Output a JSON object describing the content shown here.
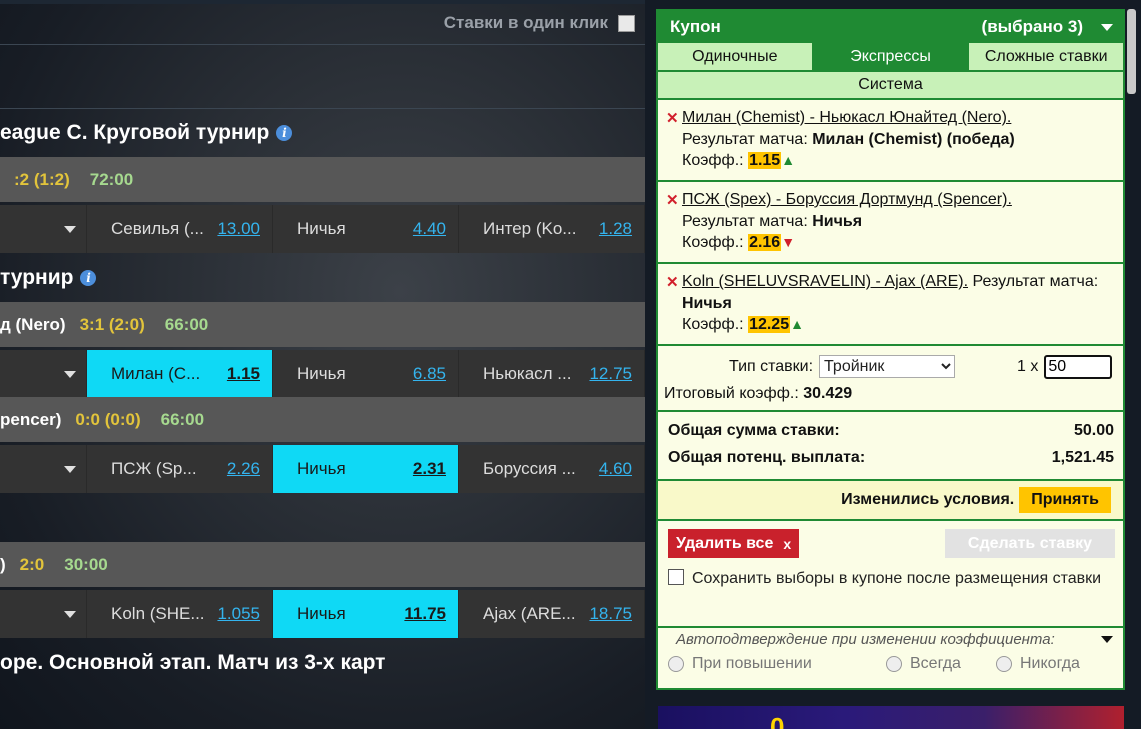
{
  "oneclick": {
    "label": "Ставки в один клик"
  },
  "leagues": [
    {
      "title": "eague C. Круговой турнир"
    },
    {
      "title": "турнир"
    },
    {
      "title": "ope. Основной этап. Матч из 3-х карт"
    }
  ],
  "matches": [
    {
      "name": "",
      "score": ":2 (1:2)",
      "time": "72:00",
      "odds": [
        {
          "name": "Севилья (...",
          "val": "13.00"
        },
        {
          "name": "Ничья",
          "val": "4.40"
        },
        {
          "name": "Интер (Ko...",
          "val": "1.28"
        }
      ]
    },
    {
      "name": "д (Nero)",
      "score": "3:1 (2:0)",
      "time": "66:00",
      "odds": [
        {
          "name": "Милан (C...",
          "val": "1.15"
        },
        {
          "name": "Ничья",
          "val": "6.85"
        },
        {
          "name": "Ньюкасл ...",
          "val": "12.75"
        }
      ]
    },
    {
      "name": "pencer)",
      "score": "0:0 (0:0)",
      "time": "66:00",
      "odds": [
        {
          "name": "ПСЖ (Sp...",
          "val": "2.26"
        },
        {
          "name": "Ничья",
          "val": "2.31"
        },
        {
          "name": "Боруссия ...",
          "val": "4.60"
        }
      ]
    },
    {
      "name": ")",
      "score": "2:0",
      "time": "30:00",
      "odds": [
        {
          "name": "Koln (SHE...",
          "val": "1.055"
        },
        {
          "name": "Ничья",
          "val": "11.75"
        },
        {
          "name": "Ajax (ARE...",
          "val": "18.75"
        }
      ]
    }
  ],
  "coupon": {
    "title": "Купон",
    "selected": "(выбрано 3)",
    "tabs": [
      "Одиночные",
      "Экспрессы",
      "Сложные ставки"
    ],
    "system": "Система",
    "bets": [
      {
        "event": "Милан (Chemist) - Ньюкасл Юнайтед (Nero).",
        "market": "Результат матча:",
        "pick": "Милан (Chemist) (победа)",
        "coef_label": "Коэфф.:",
        "coef": "1.15",
        "trend": "▲"
      },
      {
        "event": "ПСЖ (Spex) - Боруссия Дортмунд (Spencer).",
        "market": "Результат матча:",
        "pick": "Ничья",
        "coef_label": "Коэфф.:",
        "coef": "2.16",
        "trend": "▼"
      },
      {
        "event": "Koln (SHELUVSRAVELIN) - Ajax (ARE).",
        "market": "Результат матча:",
        "pick": "Ничья",
        "coef_label": "Коэфф.:",
        "coef": "12.25",
        "trend": "▲"
      }
    ],
    "bet_type_label": "Тип ставки:",
    "bet_type": "Тройник",
    "multiplier": "1 x",
    "amount": "50",
    "total_coef_label": "Итоговый коэфф.:",
    "total_coef": "30.429",
    "total_stake_label": "Общая сумма ставки:",
    "total_stake": "50.00",
    "payout_label": "Общая потенц. выплата:",
    "payout": "1,521.45",
    "changed_label": "Изменились условия.",
    "accept_label": "Принять",
    "delete_all": "Удалить все",
    "delete_x": "x",
    "make_bet": "Сделать ставку",
    "keep_label": "Сохранить выборы в купоне после размещения ставки",
    "auto_title": "Автоподтверждение при изменении коэффициента:",
    "auto_options": [
      "При повышении",
      "Всегда",
      "Никогда"
    ]
  },
  "banner": {
    "text": "0"
  },
  "colors": {
    "accent": "#1f8a33",
    "selected": "#0fd9f5",
    "odds_link": "#34b4ee",
    "coef_bg": "#ffc400",
    "delete": "#c9212c"
  }
}
